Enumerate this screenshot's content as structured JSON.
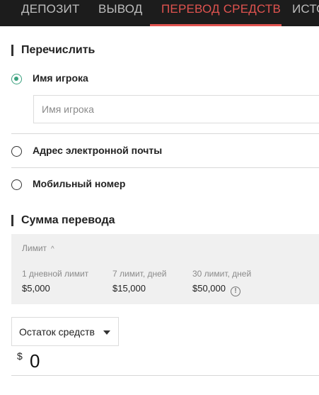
{
  "nav": {
    "tabs": [
      {
        "label": "ДЕПОЗИТ",
        "active": false
      },
      {
        "label": "ВЫВОД",
        "active": false
      },
      {
        "label": "ПЕРЕВОД СРЕДСТВ",
        "active": true
      },
      {
        "label": "ИСТО",
        "active": false
      }
    ],
    "active_color": "#e0534f"
  },
  "transfer": {
    "title": "Перечислить",
    "options": [
      {
        "label": "Имя игрока",
        "selected": true
      },
      {
        "label": "Адрес электронной почты",
        "selected": false
      },
      {
        "label": "Мобильный номер",
        "selected": false
      }
    ],
    "player_input": {
      "value": "",
      "placeholder": "Имя игрока"
    }
  },
  "amount": {
    "title": "Сумма перевода",
    "limits": {
      "header": "Лимит",
      "items": [
        {
          "label": "1 дневной лимит",
          "value": "$5,000"
        },
        {
          "label": "7 лимит, дней",
          "value": "$15,000"
        },
        {
          "label": "30 лимит, дней",
          "value": "$50,000"
        }
      ]
    },
    "dropdown": {
      "selected": "Остаток средств"
    },
    "currency": "$",
    "value": "0"
  },
  "colors": {
    "radio_selected": "#3aa17e",
    "nav_bg": "#1c1c1c"
  }
}
